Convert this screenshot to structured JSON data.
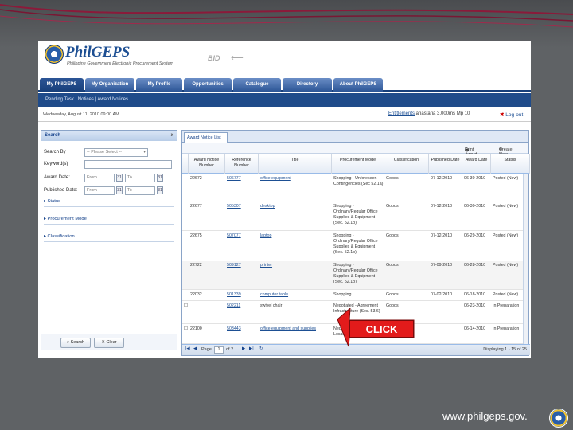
{
  "app": {
    "logo_text": "PhilGEPS",
    "logo_subtitle": "Philippine Government Electronic Procurement System",
    "bid_label": "BID"
  },
  "tabs": [
    {
      "label": "My PhilGEPS",
      "active": true
    },
    {
      "label": "My Organization"
    },
    {
      "label": "My Profile"
    },
    {
      "label": "Opportunities"
    },
    {
      "label": "Catalogue"
    },
    {
      "label": "Directory"
    },
    {
      "label": "About PhilGEPS"
    }
  ],
  "subnav": "Pending Task  |  Notices  |  Award Notices",
  "status": {
    "date": "Wednesday, August 11, 2010 09:00 AM",
    "user_link": "Entitlements",
    "user_rest": " anastaria 3,000ms  Mp 10",
    "logout": "Log-out"
  },
  "search_panel": {
    "title": "Search",
    "close": "x",
    "search_by_label": "Search By",
    "search_by_value": "-- Please Select --",
    "keywords_label": "Keyword(s)",
    "award_date_label": "Award Date:",
    "published_date_label": "Published Date:",
    "from_placeholder": "From",
    "to_placeholder": "To",
    "cal_icon": "31",
    "sections": [
      "Status",
      "Procurement Mode",
      "Classification"
    ],
    "search_button": "Search",
    "clear_button": "Clear"
  },
  "grid": {
    "tab": "Award Notice List",
    "toolbar_print": "Print Award",
    "toolbar_create": "Create New",
    "columns": [
      "Award Notice Number",
      "Reference Number",
      "Title",
      "Procurement Mode",
      "Classification",
      "Published Date",
      "Award Date",
      "Status"
    ],
    "rows": [
      {
        "award": "22672",
        "ref": "506777",
        "title": "office equipment",
        "mode": "Shopping - Unforeseen Contingencies (Sec 52.1a)",
        "class": "Goods",
        "pub": "07-12-2010",
        "date": "06-30-2010",
        "status": "Posted (New)"
      },
      {
        "award": "22677",
        "ref": "505307",
        "title": "desktop",
        "mode": "Shopping - Ordinary/Regular Office Supplies & Equipment (Sec. 52.1b)",
        "class": "Goods",
        "pub": "07-12-2010",
        "date": "06-30-2010",
        "status": "Posted (New)"
      },
      {
        "award": "22675",
        "ref": "507077",
        "title": "laptop",
        "mode": "Shopping - Ordinary/Regular Office Supplies & Equipment (Sec. 52.1b)",
        "class": "Goods",
        "pub": "07-12-2010",
        "date": "06-29-2010",
        "status": "Posted (New)"
      },
      {
        "award": "22722",
        "ref": "509127",
        "title": "printer",
        "mode": "Shopping - Ordinary/Regular Office Supplies & Equipment (Sec. 52.1b)",
        "class": "Goods",
        "pub": "07-09-2010",
        "date": "06-28-2010",
        "status": "Posted (New)"
      },
      {
        "award": "22032",
        "ref": "501339",
        "title": "computer table",
        "mode": "Shopping",
        "class": "Goods",
        "pub": "07-02-2010",
        "date": "06-18-2010",
        "status": "Posted (New)"
      },
      {
        "award": "",
        "ref": "502211",
        "title": "swivel chair",
        "mode": "Negotiated - Agreement Infrastructure (Sec. 53.6)",
        "class": "Goods",
        "pub": "",
        "date": "06-23-2010",
        "status": "In Preparation"
      },
      {
        "award": "22100",
        "ref": "503443",
        "title": "office equipment and supplies",
        "mode": "Negotiated - Procurement Local Procurement",
        "class": "Goods",
        "pub": "",
        "date": "06-14-2010",
        "status": "In Preparation"
      }
    ],
    "pager_page_label": "Page",
    "pager_page": "1",
    "pager_of": "of 2",
    "pager_display": "Displaying 1 - 15 of 25"
  },
  "callout": "CLICK",
  "footer_site": "www.philgeps.gov.",
  "colors": {
    "accent": "#1f4b8a",
    "callout": "#e31b1b"
  }
}
